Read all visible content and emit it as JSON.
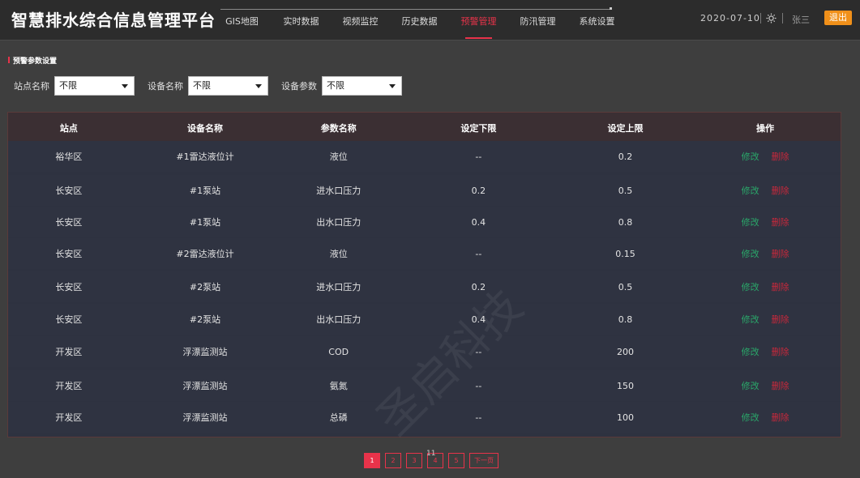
{
  "app": {
    "title": "智慧排水综合信息管理平台",
    "nav": [
      {
        "label": "GIS地图",
        "active": false
      },
      {
        "label": "实时数据",
        "active": false
      },
      {
        "label": "视频监控",
        "active": false
      },
      {
        "label": "历史数据",
        "active": false
      },
      {
        "label": "预警管理",
        "active": true
      },
      {
        "label": "防汛管理",
        "active": false
      },
      {
        "label": "系统设置",
        "active": false
      }
    ],
    "date": "2020-07-10",
    "user": "张三",
    "logout_label": "退出",
    "colors": {
      "accent": "#e8334a",
      "logout": "#f0901a",
      "edit": "#2aa86a",
      "delete": "#c8283c"
    },
    "icons": {
      "settings": "sun-gear-icon"
    }
  },
  "section": {
    "title": "预警参数设置",
    "filters": [
      {
        "label": "站点名称",
        "value": "不限"
      },
      {
        "label": "设备名称",
        "value": "不限"
      },
      {
        "label": "设备参数",
        "value": "不限"
      }
    ]
  },
  "table": {
    "headers": [
      "站点",
      "设备名称",
      "参数名称",
      "设定下限",
      "设定上限",
      "操作"
    ],
    "edit_label": "修改",
    "delete_label": "删除",
    "rows": [
      [
        "裕华区",
        "#1雷达液位计",
        "液位",
        "--",
        "0.2"
      ],
      [
        "长安区",
        "#1泵站",
        "进水口压力",
        "0.2",
        "0.5"
      ],
      [
        "长安区",
        "#1泵站",
        "出水口压力",
        "0.4",
        "0.8"
      ],
      [
        "长安区",
        "#2雷达液位计",
        "液位",
        "--",
        "0.15"
      ],
      [
        "长安区",
        "#2泵站",
        "进水口压力",
        "0.2",
        "0.5"
      ],
      [
        "长安区",
        "#2泵站",
        "出水口压力",
        "0.4",
        "0.8"
      ],
      [
        "开发区",
        "浮漂监测站",
        "COD",
        "--",
        "200"
      ],
      [
        "开发区",
        "浮漂监测站",
        "氨氮",
        "--",
        "150"
      ],
      [
        "开发区",
        "浮漂监测站",
        "总磷",
        "--",
        "100"
      ]
    ]
  },
  "watermark": "圣启科技",
  "pagination": {
    "pages": [
      "1",
      "2",
      "3",
      "4",
      "5"
    ],
    "active_page": "1",
    "next_label": "下一页",
    "total": "11"
  }
}
